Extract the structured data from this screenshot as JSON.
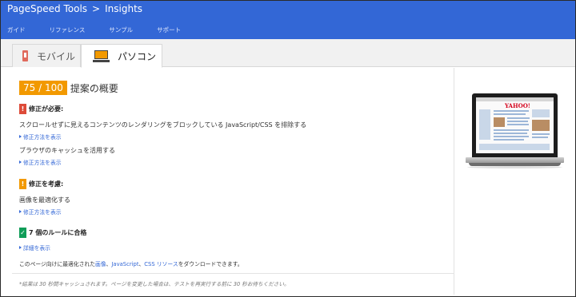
{
  "header": {
    "product": "PageSpeed Tools",
    "separator": ">",
    "page": "Insights",
    "nav": [
      "ガイド",
      "リファレンス",
      "サンプル",
      "サポート"
    ]
  },
  "tabs": {
    "mobile": "モバイル",
    "desktop": "パソコン",
    "active": "desktop"
  },
  "summary": {
    "score": "75 / 100",
    "title": "提案の概要"
  },
  "sections": {
    "should_fix": {
      "icon": "!",
      "heading": "修正が必要:",
      "rules": [
        {
          "text": "スクロールせずに見えるコンテンツのレンダリングをブロックしている JavaScript/CSS を排除する",
          "link": "修正方法を表示"
        },
        {
          "text": "ブラウザのキャッシュを活用する",
          "link": "修正方法を表示"
        }
      ]
    },
    "consider_fixing": {
      "icon": "!",
      "heading": "修正を考慮:",
      "rules": [
        {
          "text": "画像を最適化する",
          "link": "修正方法を表示"
        }
      ]
    },
    "passed": {
      "icon": "✓",
      "heading": "7 個のルールに合格",
      "link": "詳細を表示"
    }
  },
  "download": {
    "prefix": "このページ向けに最適化された",
    "link_images": "画像",
    "sep1": "、",
    "link_js": "JavaScript",
    "sep2": "、",
    "link_css": "CSS リソース",
    "suffix": "をダウンロードできます。"
  },
  "cache_note": "*結果は 30 秒間キャッシュされます。ページを変更した場合は、テストを再実行する前に 30 秒お待ちください。",
  "preview": {
    "screen_logo": "YAHOO!"
  },
  "colors": {
    "header": "#3367d6",
    "score_badge": "#f29900",
    "should_fix": "#dd4b39",
    "consider": "#f29900",
    "passed": "#0f9d58",
    "link": "#3367d6"
  }
}
